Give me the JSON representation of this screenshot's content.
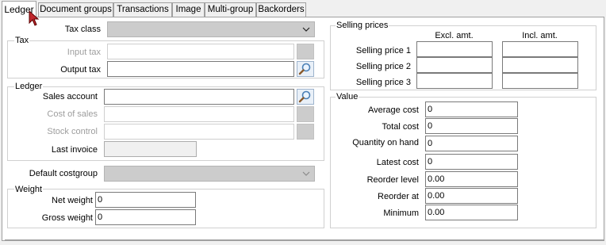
{
  "tabs": [
    "Ledger",
    "Document groups",
    "Transactions",
    "Image",
    "Multi-group",
    "Backorders"
  ],
  "tax_class": {
    "label": "Tax class",
    "value": ""
  },
  "tax": {
    "title": "Tax",
    "input_tax_label": "Input tax",
    "output_tax_label": "Output tax",
    "input_tax_value": "",
    "output_tax_value": ""
  },
  "ledger": {
    "title": "Ledger",
    "sales_account_label": "Sales account",
    "cost_of_sales_label": "Cost of sales",
    "stock_control_label": "Stock control",
    "last_invoice_label": "Last invoice",
    "sales_account_value": "",
    "cost_of_sales_value": "",
    "stock_control_value": "",
    "last_invoice_value": ""
  },
  "default_costgroup": {
    "label": "Default costgroup",
    "value": ""
  },
  "weight": {
    "title": "Weight",
    "net_label": "Net weight",
    "gross_label": "Gross weight",
    "net_value": "0",
    "gross_value": "0"
  },
  "selling_prices": {
    "title": "Selling prices",
    "excl_header": "Excl. amt.",
    "incl_header": "Incl. amt.",
    "rows": [
      {
        "label": "Selling price 1",
        "excl": "",
        "incl": ""
      },
      {
        "label": "Selling price 2",
        "excl": "",
        "incl": ""
      },
      {
        "label": "Selling price 3",
        "excl": "",
        "incl": ""
      }
    ]
  },
  "value": {
    "title": "Value",
    "rows": [
      {
        "label": "Average cost",
        "value": "0"
      },
      {
        "label": "Total cost",
        "value": "0"
      },
      {
        "label": "Quantity on hand",
        "value": "0"
      },
      {
        "label": "Latest cost",
        "value": "0"
      },
      {
        "label": "Reorder level",
        "value": "0.00"
      },
      {
        "label": "Reorder at",
        "value": "0.00"
      },
      {
        "label": "Minimum",
        "value": "0.00"
      }
    ]
  },
  "icons": {
    "find": "magnifier-icon",
    "dropdown": "chevron-down-icon",
    "cursor": "mouse-pointer-icon"
  }
}
